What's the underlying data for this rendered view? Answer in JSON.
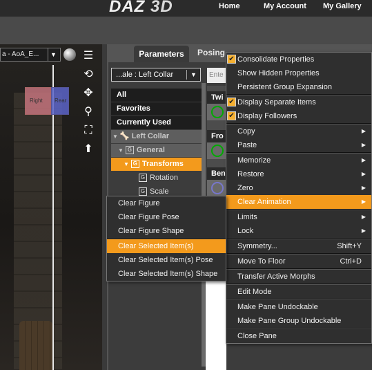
{
  "header": {
    "logo_main": "DAZ",
    "logo_3d": "3D",
    "nav": [
      "Home",
      "My Account",
      "My Gallery"
    ]
  },
  "viewport": {
    "title": "a - AoA_E...",
    "cube_left": "Right",
    "cube_right": "Rear"
  },
  "pane": {
    "tab_parameters": "Parameters",
    "tab_posing": "Posing",
    "selector": "...ale : Left Collar",
    "search_placeholder": "Ente",
    "tree": {
      "all": "All",
      "favorites": "Favorites",
      "currently_used": "Currently Used",
      "left_collar": "Left Collar",
      "general": "General",
      "transforms": "Transforms",
      "rotation": "Rotation",
      "scale": "Scale"
    },
    "params": [
      "Twi",
      "Fro",
      "Ben"
    ]
  },
  "main_menu": {
    "items": [
      {
        "label": "Consolidate Properties",
        "checked": true
      },
      {
        "label": "Show Hidden Properties"
      },
      {
        "label": "Persistent Group Expansion"
      },
      {
        "label": "Display Separate Items",
        "checked": true
      },
      {
        "label": "Display Followers",
        "checked": true
      },
      {
        "label": "Copy",
        "submenu": true
      },
      {
        "label": "Paste",
        "submenu": true
      },
      {
        "label": "Memorize",
        "submenu": true
      },
      {
        "label": "Restore",
        "submenu": true
      },
      {
        "label": "Zero",
        "submenu": true
      },
      {
        "label": "Clear Animation",
        "submenu": true,
        "highlighted": true
      },
      {
        "label": "Limits",
        "submenu": true
      },
      {
        "label": "Lock",
        "submenu": true
      },
      {
        "label": "Symmetry...",
        "shortcut": "Shift+Y"
      },
      {
        "label": "Move To Floor",
        "shortcut": "Ctrl+D"
      },
      {
        "label": "Transfer Active Morphs"
      },
      {
        "label": "Edit Mode"
      },
      {
        "label": "Make Pane Undockable"
      },
      {
        "label": "Make Pane Group Undockable"
      },
      {
        "label": "Close Pane"
      }
    ]
  },
  "sub_menu": {
    "items": [
      {
        "label": "Clear Figure"
      },
      {
        "label": "Clear Figure Pose"
      },
      {
        "label": "Clear Figure Shape"
      },
      {
        "label": "Clear Selected Item(s)",
        "highlighted": true
      },
      {
        "label": "Clear Selected Item(s) Pose"
      },
      {
        "label": "Clear Selected Item(s) Shape"
      }
    ]
  },
  "colors": {
    "accent": "#f39a1c",
    "menu_bg": "#2f2f2f"
  }
}
